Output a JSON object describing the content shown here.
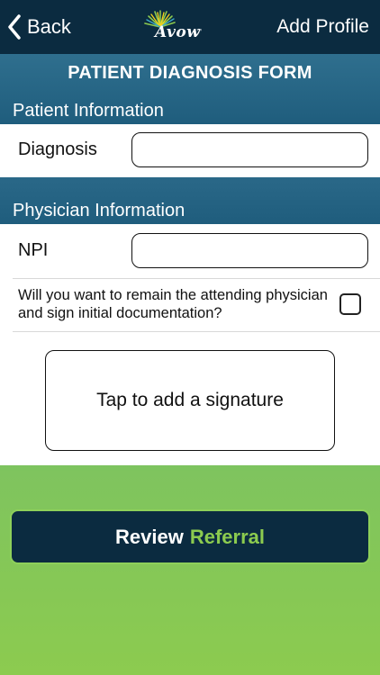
{
  "nav": {
    "back_label": "Back",
    "logo_text": "Avow",
    "logo_tm": "™",
    "add_profile_label": "Add Profile"
  },
  "form": {
    "title": "PATIENT DIAGNOSIS FORM",
    "patient_section": {
      "label": "Patient Information",
      "diagnosis_label": "Diagnosis",
      "diagnosis_value": ""
    },
    "physician_section": {
      "label": "Physician Information",
      "npi_label": "NPI",
      "npi_value": "",
      "attending_question": "Will you want to remain the attending physician and sign initial documentation?",
      "attending_checked": false
    },
    "signature_prompt": "Tap to add a signature"
  },
  "footer": {
    "review_label": "Review",
    "referral_label": "Referral"
  },
  "colors": {
    "navbar_bg": "#0b2b40",
    "band_bg": "#1f5d7d",
    "accent_green": "#8ccb4f",
    "gradient_teal": "#0f7e86"
  },
  "icons": {
    "back": "chevron-left-icon",
    "logo": "avow-sunburst-logo"
  }
}
